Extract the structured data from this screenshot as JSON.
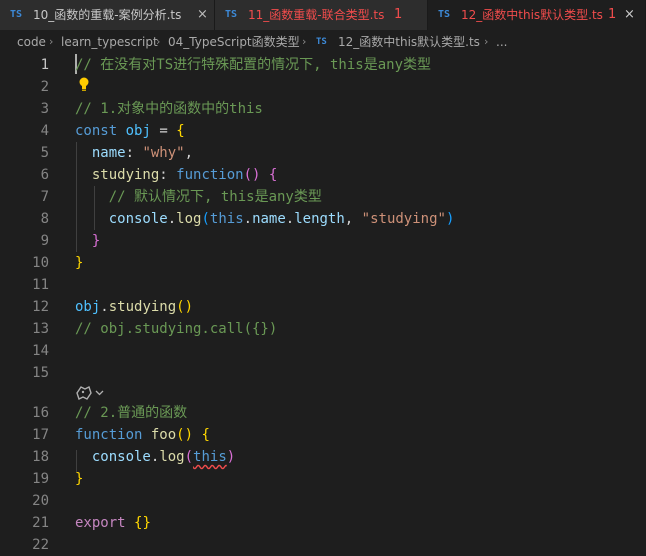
{
  "tabs": [
    {
      "ts": "TS",
      "name": "10_函数的重载-案例分析.ts",
      "close": "×",
      "count": ""
    },
    {
      "ts": "TS",
      "name": "11_函数重载-联合类型.ts",
      "close": "",
      "count": "1"
    },
    {
      "ts": "TS",
      "name": "12_函数中this默认类型.ts",
      "close": "×",
      "count": "1"
    }
  ],
  "breadcrumb": {
    "parts": [
      "code",
      "learn_typescript",
      "04_TypeScript函数类型",
      "12_函数中this默认类型.ts",
      "..."
    ],
    "sep": "›",
    "ts": "TS"
  },
  "editor": {
    "line_numbers": [
      "1",
      "2",
      "3",
      "4",
      "5",
      "6",
      "7",
      "8",
      "9",
      "10",
      "11",
      "12",
      "13",
      "14",
      "15",
      "16",
      "17",
      "18",
      "19",
      "20",
      "21",
      "22"
    ],
    "tokens": {
      "l1": "// 在没有对TS进行特殊配置的情况下, this是any类型",
      "l3": "// 1.对象中的函数中的this",
      "l4_const": "const",
      "l4_obj": "obj",
      "l4_eq": " = ",
      "l4_brace": "{",
      "l5_name": "name",
      "l5_colon": ": ",
      "l5_str": "\"why\"",
      "l5_comma": ",",
      "l6_key": "studying",
      "l6_colon": ": ",
      "l6_fn": "function",
      "l6_paren": "()",
      "l6_brace": "{",
      "l7": "// 默认情况下, this是any类型",
      "l8_console": "console",
      "l8_dot1": ".",
      "l8_log": "log",
      "l8_p1": "(",
      "l8_this": "this",
      "l8_dot2": ".",
      "l8_name": "name",
      "l8_dot3": ".",
      "l8_length": "length",
      "l8_comma": ", ",
      "l8_str": "\"studying\"",
      "l8_p2": ")",
      "l9": "}",
      "l10": "}",
      "l12_obj": "obj",
      "l12_dot": ".",
      "l12_fn": "studying",
      "l12_paren": "()",
      "l13": "// obj.studying.call({})",
      "l16": "// 2.普通的函数",
      "l17_kw": "function",
      "l17_name": "foo",
      "l17_paren": "()",
      "l17_brace": "{",
      "l18_console": "console",
      "l18_dot": ".",
      "l18_log": "log",
      "l18_p1": "(",
      "l18_this": "this",
      "l18_p2": ")",
      "l19": "}",
      "l21_kw": "export",
      "l21_braces": "{}"
    }
  },
  "icons": {
    "bulb": "lightbulb-icon",
    "codelens": "copilot-icon"
  }
}
